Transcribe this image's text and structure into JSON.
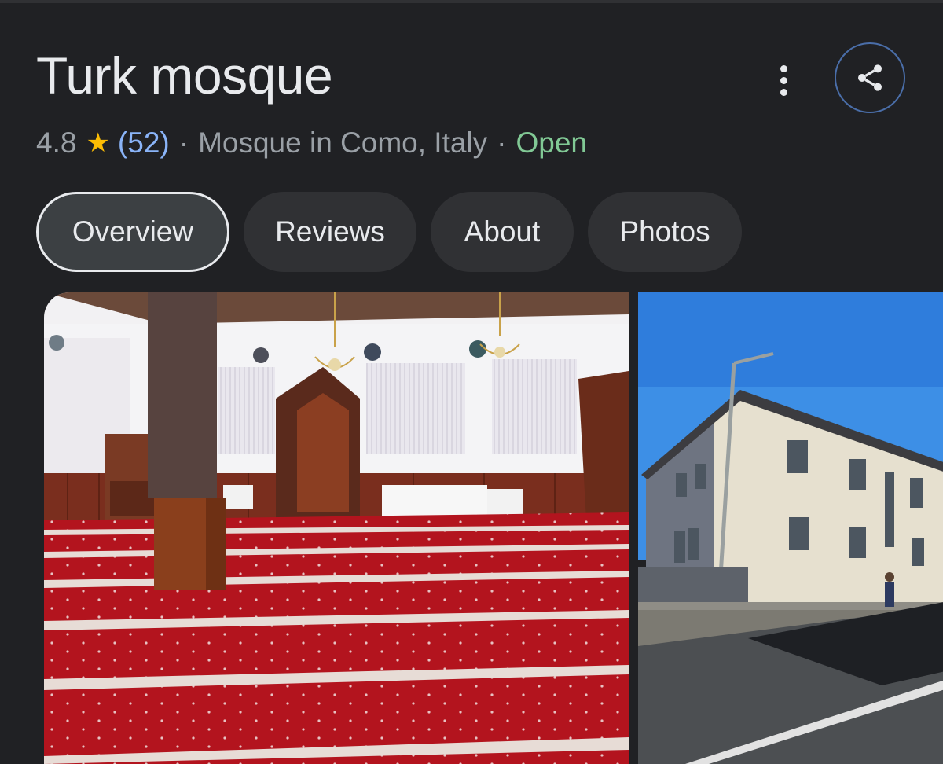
{
  "place": {
    "name": "Turk mosque",
    "rating": "4.8",
    "review_count": "(52)",
    "separator": "·",
    "category_location": "Mosque in Como, Italy",
    "status": "Open"
  },
  "header": {
    "more_icon": "more-vert-icon",
    "share_icon": "share-icon",
    "star_icon": "star-icon"
  },
  "tabs": [
    {
      "label": "Overview",
      "active": true
    },
    {
      "label": "Reviews",
      "active": false
    },
    {
      "label": "About",
      "active": false
    },
    {
      "label": "Photos",
      "active": false
    }
  ],
  "photos": [
    {
      "description_name": "interior-photo"
    },
    {
      "description_name": "exterior-photo"
    }
  ],
  "colors": {
    "background": "#202124",
    "text": "#e8eaed",
    "secondary_text": "#9aa0a6",
    "link": "#8ab4f8",
    "open_status": "#81c995",
    "star": "#fbbc04",
    "chip": "#303134",
    "share_border": "#4a6ea9"
  }
}
